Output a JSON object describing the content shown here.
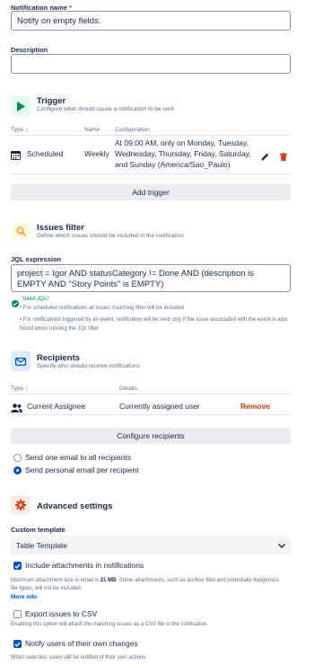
{
  "notification_name": {
    "label": "Notification name",
    "required": "*",
    "value": "Notify on empty fields."
  },
  "description": {
    "label": "Description",
    "value": ""
  },
  "trigger": {
    "title": "Trigger",
    "subtitle": "Configure what should cause a notification to be sent",
    "columns": [
      "Type",
      "Name",
      "Configuration"
    ],
    "row": {
      "type": "Scheduled",
      "name": "Weekly",
      "configuration": "At 09:00 AM, only on Monday, Tuesday, Wednesday, Thursday, Friday, Saturday, and Sunday (America/Sao_Paulo)"
    },
    "add_button": "Add trigger",
    "icon_color": "#00875a"
  },
  "issues_filter": {
    "title": "Issues filter",
    "subtitle": "Define which issues should be included in the notification",
    "jql_label": "JQL expression",
    "jql_value": "project = Igor  AND statusCategory != Done AND (description is EMPTY AND \"Story Points\" is EMPTY)",
    "valid_text": "Valid JQL!",
    "notes": [
      "For scheduled notifications all issues matching filter will be included",
      "For notifications triggered by an event, notification will be sent only if the issue associated with the event is also found when running the JQL filter"
    ],
    "icon_color": "#ff991f"
  },
  "recipients": {
    "title": "Recipients",
    "subtitle": "Specify who should receive notifications",
    "columns": [
      "Type",
      "Details"
    ],
    "row": {
      "type": "Current Assignee",
      "details": "Currently assigned user",
      "action": "Remove"
    },
    "configure_button": "Configure recipients",
    "options": [
      "Send one email to all recipients",
      "Send personal email per recipient"
    ],
    "selected_option": 1,
    "icon_color": "#0052cc"
  },
  "advanced": {
    "title": "Advanced settings",
    "custom_template_label": "Custom template",
    "template_value": "Table Template",
    "include_attachments": {
      "label": "Include attachments in notifications",
      "checked": true
    },
    "attachment_note_prefix": "Maximum attachment size in email is ",
    "attachment_size": "21 MB",
    "attachment_note_suffix": ". Some attachments, such as archive files and potentially dangerous file types, will not be included.",
    "more_info": "More info",
    "export_csv": {
      "label": "Export issues to CSV",
      "checked": false
    },
    "export_note": "Enabling this option will attach the matching issues as a CSV file in the notification.",
    "notify_own": {
      "label": "Notify users of their own changes",
      "checked": true
    },
    "notify_note": "When selected, users will be notified of their own actions",
    "icon_color": "#de350b"
  }
}
